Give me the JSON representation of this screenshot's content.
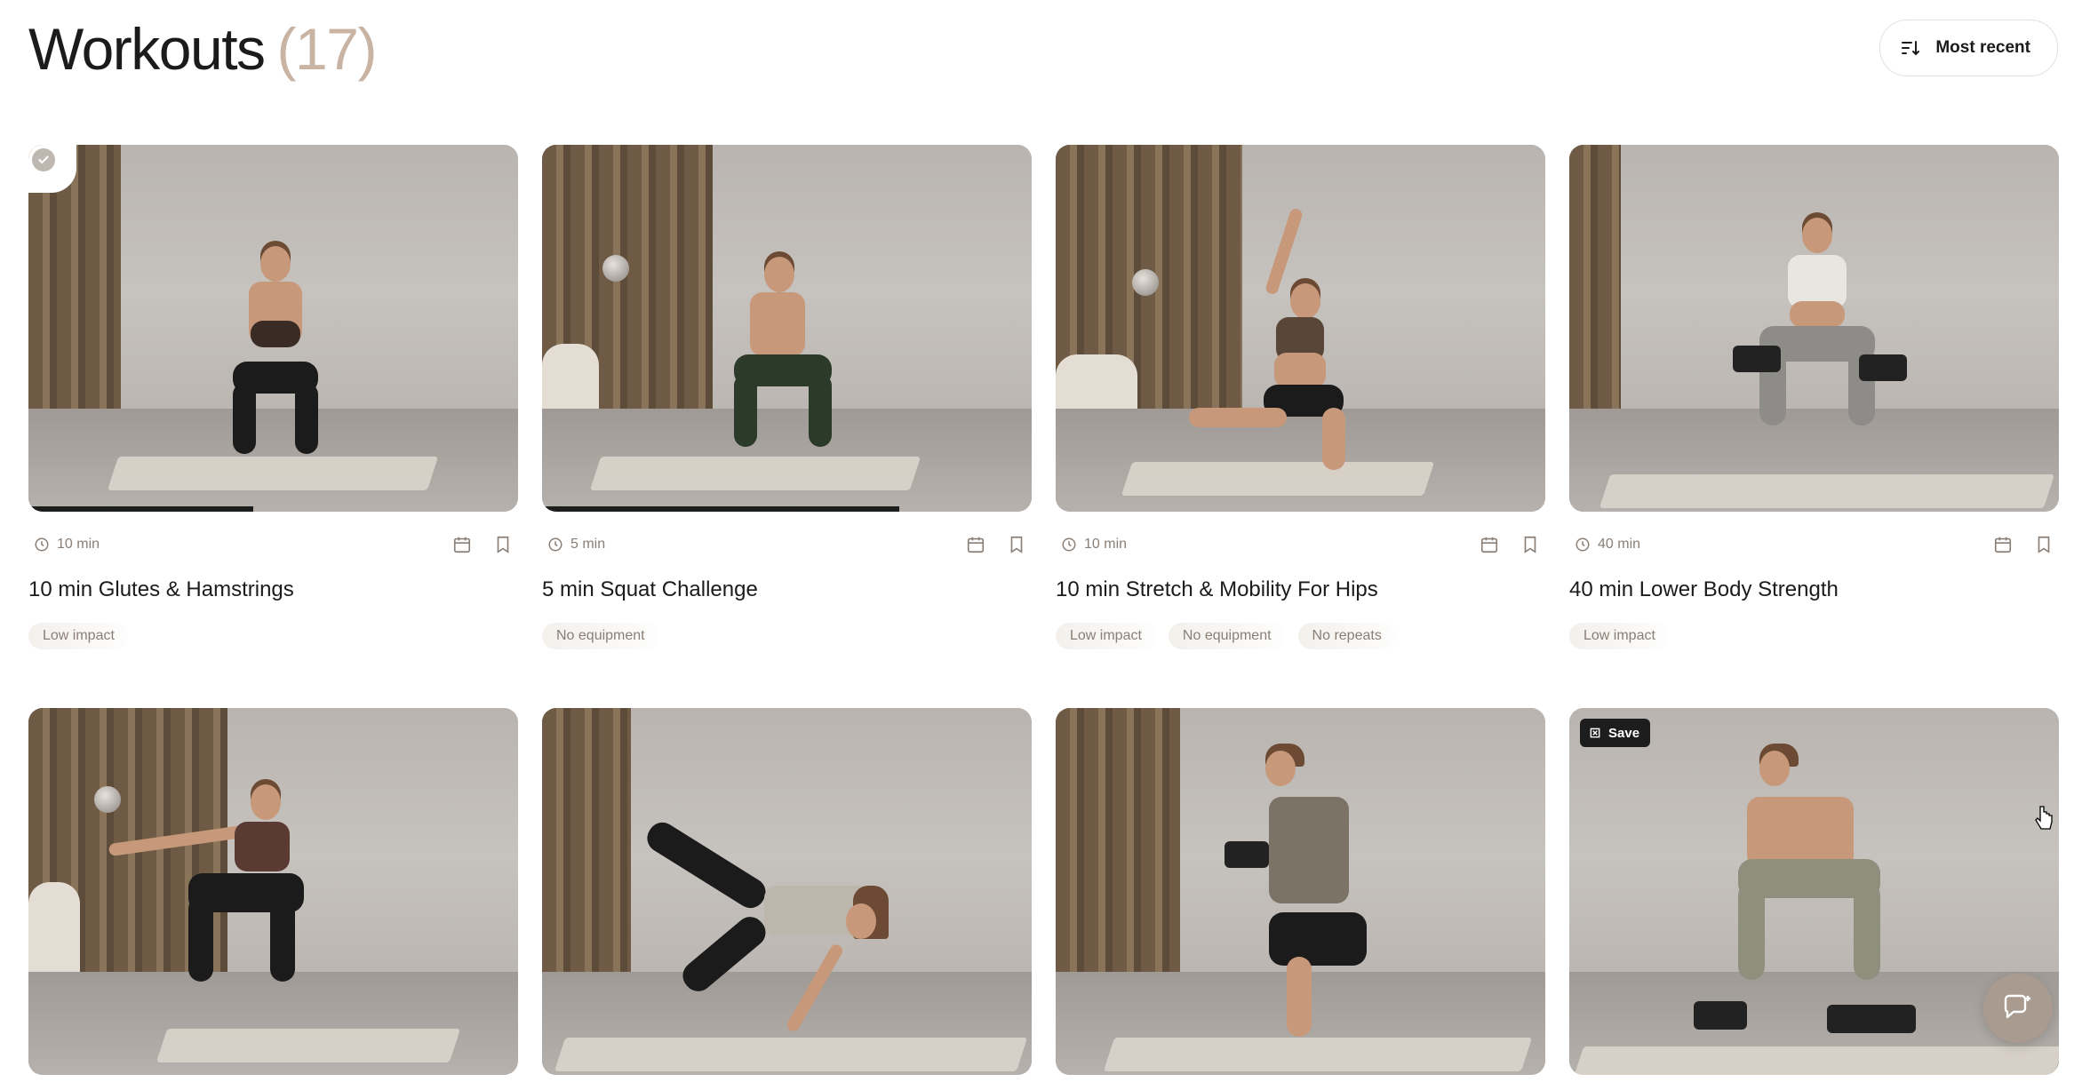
{
  "header": {
    "title": "Workouts",
    "count": "(17)",
    "sort_label": "Most recent",
    "sort_icon": "sort-icon"
  },
  "colors": {
    "count": "#c9b3a3",
    "tag_text": "#8a7f76",
    "chat_fab": "#a99b8f"
  },
  "workouts": [
    {
      "title": "10 min Glutes & Hamstrings",
      "duration": "10 min",
      "tags": [
        "Low impact"
      ],
      "completed": true,
      "progress": 0.46
    },
    {
      "title": "5 min Squat Challenge",
      "duration": "5 min",
      "tags": [
        "No equipment"
      ],
      "completed": false,
      "progress": 0.73
    },
    {
      "title": "10 min Stretch & Mobility For Hips",
      "duration": "10 min",
      "tags": [
        "Low impact",
        "No equipment",
        "No repeats"
      ],
      "completed": false,
      "progress": 0
    },
    {
      "title": "40 min Lower Body Strength",
      "duration": "40 min",
      "tags": [
        "Low impact"
      ],
      "completed": false,
      "progress": 0
    },
    {
      "title": "",
      "duration": "",
      "tags": [],
      "completed": false,
      "progress": 0
    },
    {
      "title": "",
      "duration": "",
      "tags": [],
      "completed": false,
      "progress": 0
    },
    {
      "title": "",
      "duration": "",
      "tags": [],
      "completed": false,
      "progress": 0
    },
    {
      "title": "",
      "duration": "",
      "tags": [],
      "completed": false,
      "progress": 0,
      "save_label": "Save"
    }
  ]
}
